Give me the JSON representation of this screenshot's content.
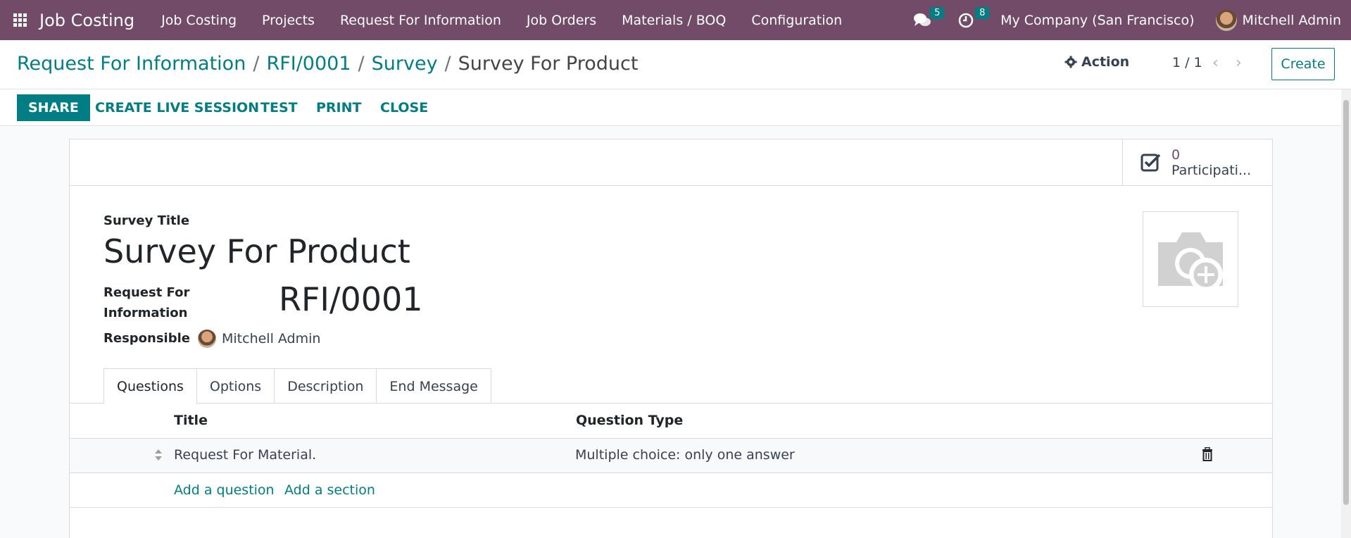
{
  "navbar": {
    "app_name": "Job Costing",
    "menu": [
      "Job Costing",
      "Projects",
      "Request For Information",
      "Job Orders",
      "Materials / BOQ",
      "Configuration"
    ],
    "messages_count": "5",
    "activities_count": "8",
    "company": "My Company (San Francisco)",
    "user": "Mitchell Admin"
  },
  "breadcrumb": {
    "items": [
      "Request For Information",
      "RFI/0001",
      "Survey"
    ],
    "separator": "/",
    "current": "Survey For Product"
  },
  "control": {
    "action_label": "Action",
    "pager": "1 / 1",
    "create_label": "Create"
  },
  "buttons": {
    "share": "SHARE",
    "create_live_session": "CREATE LIVE SESSION",
    "test": "TEST",
    "print": "PRINT",
    "close": "CLOSE"
  },
  "stat": {
    "value": "0",
    "label": "Participati..."
  },
  "form": {
    "survey_title_label": "Survey Title",
    "survey_title": "Survey For Product",
    "rfi_label_line1": "Request For",
    "rfi_label_line2": "Information",
    "rfi_value": "RFI/0001",
    "responsible_label": "Responsible",
    "responsible_value": "Mitchell Admin"
  },
  "tabs": [
    "Questions",
    "Options",
    "Description",
    "End Message"
  ],
  "table": {
    "columns": [
      "Title",
      "Question Type"
    ],
    "rows": [
      {
        "title": "Request For Material.",
        "type": "Multiple choice: only one answer"
      }
    ],
    "add_question": "Add a question",
    "add_section": "Add a section"
  },
  "colors": {
    "navbar": "#714b67",
    "accent": "#017e84"
  }
}
